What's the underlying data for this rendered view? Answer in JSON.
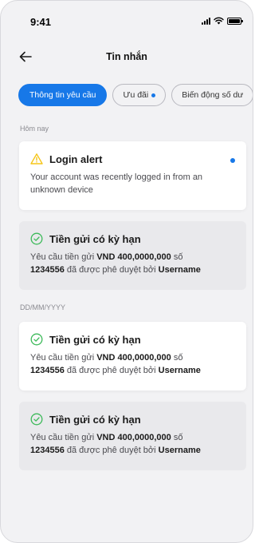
{
  "status_bar": {
    "time": "9:41"
  },
  "header": {
    "title": "Tin nhắn"
  },
  "tabs": [
    {
      "label": "Thông tin yêu cầu",
      "active": true
    },
    {
      "label": "Ưu đãi",
      "has_dot": true
    },
    {
      "label": "Biến động số dư"
    }
  ],
  "sections": [
    {
      "label": "Hôm nay"
    },
    {
      "label": "DD/MM/YYYY"
    }
  ],
  "cards": [
    {
      "icon": "warning-icon",
      "title": "Login alert",
      "body": "Your account was recently logged in from an unknown device",
      "unread": true
    },
    {
      "icon": "check-circle-icon",
      "title": "Tiền gửi có kỳ hạn",
      "body_prefix": "Yêu cầu tiền gửi ",
      "amount": "VND 400,0000,000",
      "body_mid1": " số ",
      "account": "1234556",
      "body_mid2": " đã được phê duyệt bởi ",
      "username": "Username"
    },
    {
      "icon": "check-circle-icon",
      "title": "Tiền gửi có kỳ hạn",
      "body_prefix": "Yêu cầu tiền gửi ",
      "amount": "VND 400,0000,000",
      "body_mid1": " số ",
      "account": "1234556",
      "body_mid2": " đã được phê duyệt bởi ",
      "username": "Username"
    },
    {
      "icon": "check-circle-icon",
      "title": "Tiền gửi có kỳ hạn",
      "body_prefix": "Yêu cầu tiền gửi ",
      "amount": "VND 400,0000,000",
      "body_mid1": " số ",
      "account": "1234556",
      "body_mid2": " đã được phê duyệt bởi ",
      "username": "Username"
    }
  ],
  "colors": {
    "accent": "#1778e8",
    "warning": "#f5c518",
    "success": "#3dba5a"
  }
}
